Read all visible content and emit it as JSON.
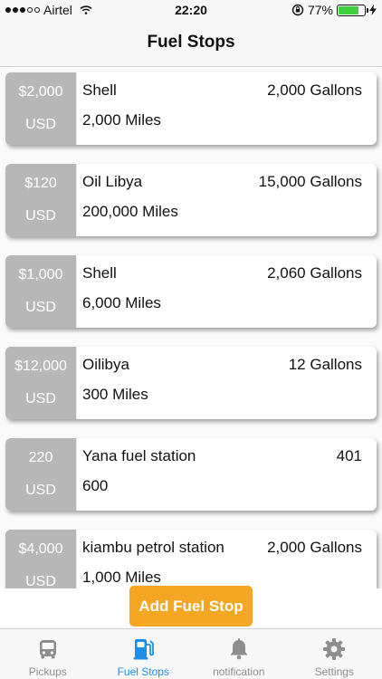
{
  "status_bar": {
    "carrier": "Airtel",
    "time": "22:20",
    "battery_percent": "77%",
    "battery_level": 0.77
  },
  "nav": {
    "title": "Fuel Stops"
  },
  "fuel_stops": [
    {
      "price": "$2,000",
      "currency": "USD",
      "name": "Shell",
      "gallons": "2,000 Gallons",
      "miles": "2,000 Miles"
    },
    {
      "price": "$120",
      "currency": "USD",
      "name": "Oil Libya",
      "gallons": "15,000 Gallons",
      "miles": "200,000 Miles"
    },
    {
      "price": "$1,000",
      "currency": "USD",
      "name": "Shell",
      "gallons": "2,060 Gallons",
      "miles": "6,000 Miles"
    },
    {
      "price": "$12,000",
      "currency": "USD",
      "name": "Oilibya",
      "gallons": "12 Gallons",
      "miles": "300 Miles"
    },
    {
      "price": "220",
      "currency": "USD",
      "name": "Yana fuel station",
      "gallons": "401",
      "miles": "600"
    },
    {
      "price": "$4,000",
      "currency": "USD",
      "name": "kiambu petrol station",
      "gallons": "2,000 Gallons",
      "miles": "1,000 Miles"
    }
  ],
  "add_button_label": "Add Fuel Stop",
  "tabs": [
    {
      "label": "Pickups",
      "icon": "bus-icon",
      "active": false
    },
    {
      "label": "Fuel  Stops",
      "icon": "gas-pump-icon",
      "active": true
    },
    {
      "label": "notification",
      "icon": "bell-icon",
      "active": false
    },
    {
      "label": "Settings",
      "icon": "gear-icon",
      "active": false
    }
  ],
  "colors": {
    "accent": "#1e8fe8",
    "button": "#f5a623",
    "price_box": "#b7b7b7",
    "inactive_tab": "#8e8e8e"
  }
}
